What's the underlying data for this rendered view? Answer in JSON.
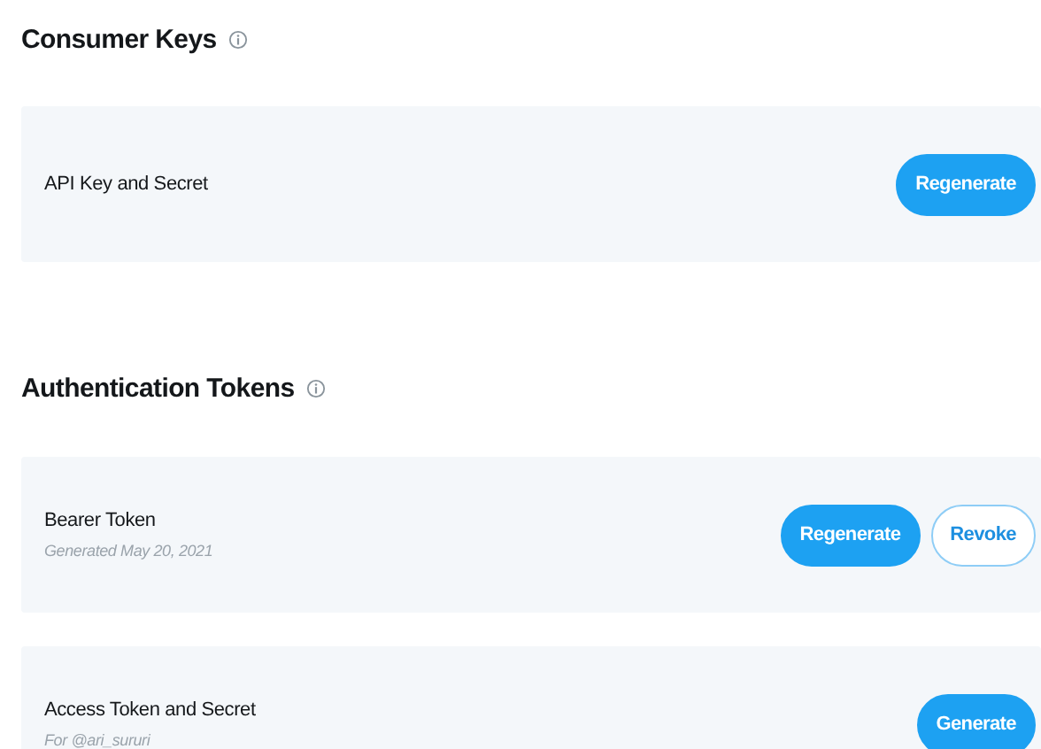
{
  "sections": [
    {
      "title": "Consumer Keys",
      "cards": [
        {
          "title": "API Key and Secret",
          "buttons": [
            {
              "label": "Regenerate",
              "kind": "primary"
            }
          ]
        }
      ]
    },
    {
      "title": "Authentication Tokens",
      "cards": [
        {
          "title": "Bearer Token",
          "subtitle": "Generated May 20, 2021",
          "buttons": [
            {
              "label": "Regenerate",
              "kind": "primary"
            },
            {
              "label": "Revoke",
              "kind": "outline"
            }
          ]
        },
        {
          "title": "Access Token and Secret",
          "subtitle": "For @ari_sururi",
          "buttons": [
            {
              "label": "Generate",
              "kind": "primary"
            }
          ]
        }
      ]
    }
  ]
}
